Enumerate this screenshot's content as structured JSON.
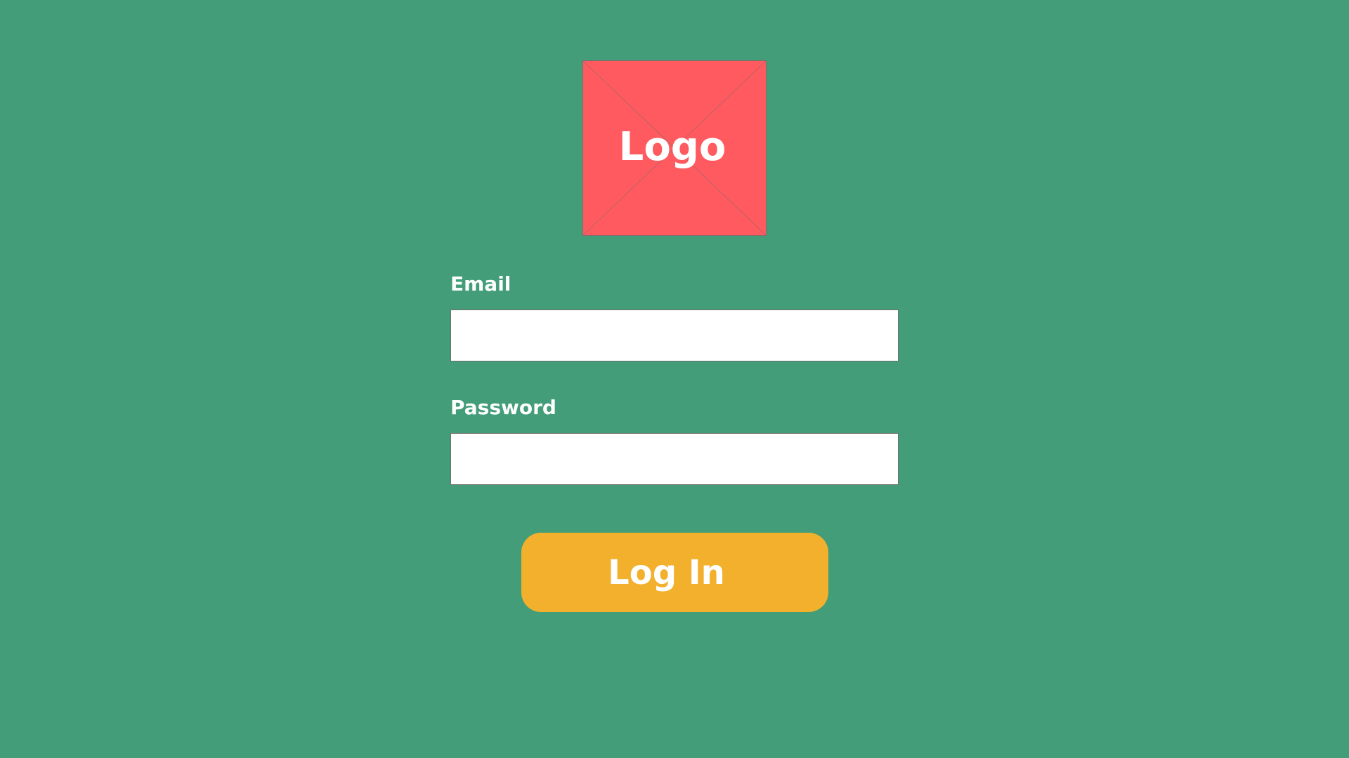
{
  "colors": {
    "background": "#429d78",
    "logo_fill": "#ff5a5f",
    "logo_cross": "#8c6a6a",
    "button": "#f2b02c",
    "text_light": "#ffffff"
  },
  "logo": {
    "text": "Logo",
    "icon": "image-placeholder-icon"
  },
  "form": {
    "email_label": "Email",
    "email_value": "",
    "email_placeholder": "",
    "password_label": "Password",
    "password_value": "",
    "password_placeholder": "",
    "submit_label": "Log In"
  }
}
